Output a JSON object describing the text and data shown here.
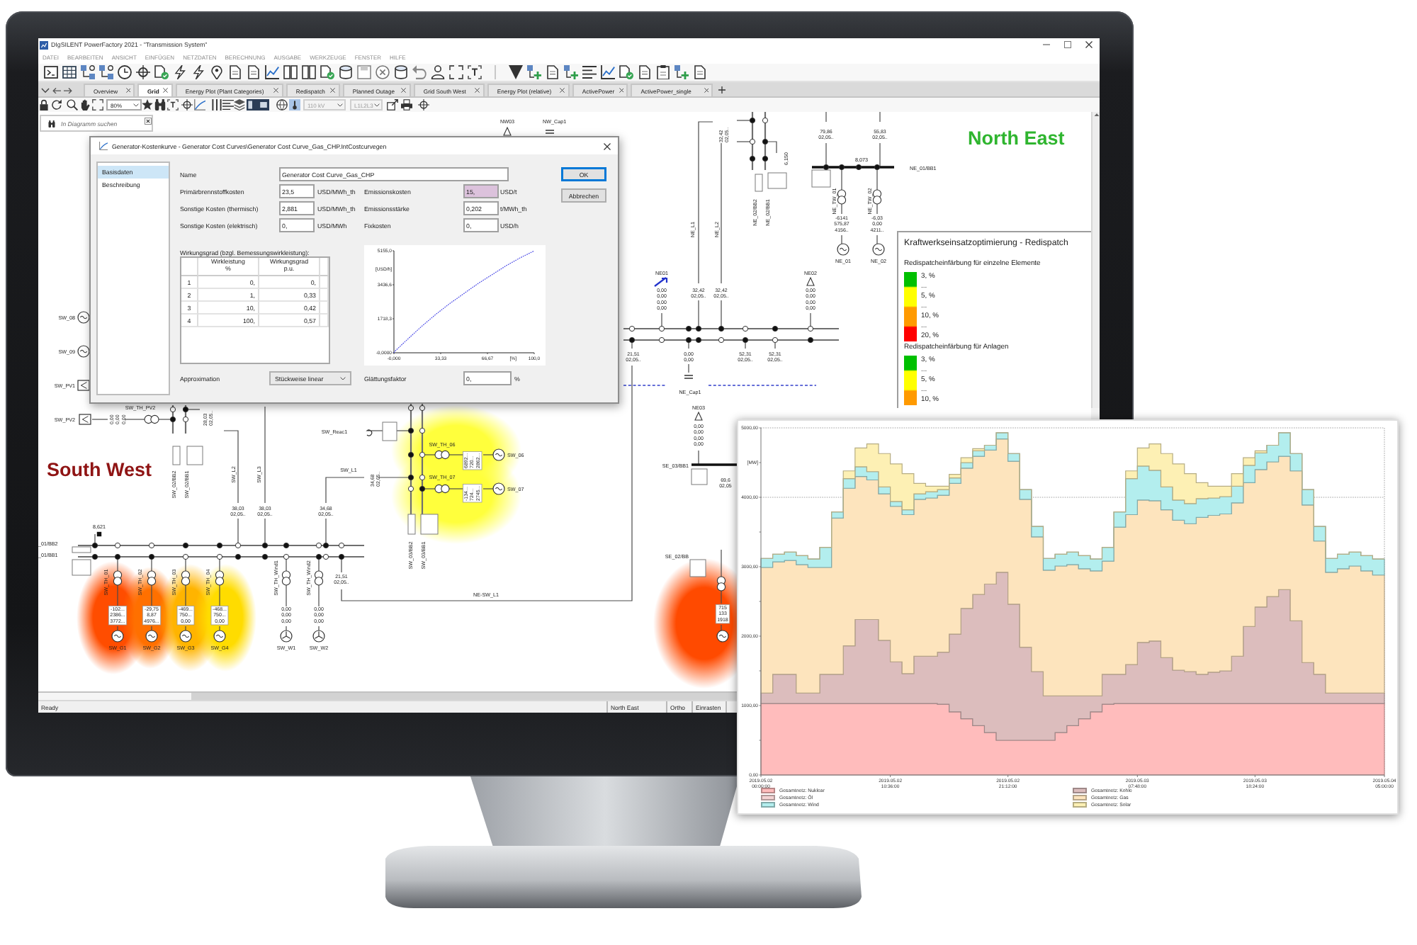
{
  "window": {
    "title": "DIgSILENT PowerFactory 2021 - \"Transmission System\"",
    "menu": [
      "DATEI",
      "BEARBEITEN",
      "ANSICHT",
      "EINFÜGEN",
      "NETZDATEN",
      "BERECHNUNG",
      "AUSGABE",
      "WERKZEUGE",
      "FENSTER",
      "HILFE"
    ]
  },
  "tabs": [
    {
      "label": "Overview",
      "selected": false
    },
    {
      "label": "Grid",
      "selected": true
    },
    {
      "label": "Energy Plot (Plant Categories)",
      "selected": false
    },
    {
      "label": "Redispatch",
      "selected": false
    },
    {
      "label": "Planned Outage",
      "selected": false
    },
    {
      "label": "Grid South West",
      "selected": false
    },
    {
      "label": "Energy Plot (relative)",
      "selected": false
    },
    {
      "label": "ActivePower",
      "selected": false
    },
    {
      "label": "ActivePower_single",
      "selected": false
    }
  ],
  "view_toolbar": {
    "zoom": {
      "value": "80%",
      "disabled": false
    },
    "voltage": {
      "value": "110 kV",
      "disabled": true
    },
    "phase": {
      "value": "L1L2L3",
      "disabled": true
    }
  },
  "diagram": {
    "search": {
      "placeholder": "In Diagramm suchen"
    },
    "regions": [
      {
        "text": "North East",
        "color": "#2fb52f"
      },
      {
        "text": "South West",
        "color": "#8f1414"
      }
    ],
    "labels": [
      "NW03",
      "NW_Cap1",
      "6,150",
      "8,073",
      "NE_01/BB1",
      "NE_02/BB2",
      "NE_02/BB1",
      "NE_TW_01",
      "NE_TW_02",
      "NE_L1",
      "NE_L2",
      "NE01",
      "NE02",
      "NE_Cap1",
      "NE03",
      "SE_03/BB1",
      "SE_02/BB",
      "SW_TH_PV2",
      "SW_02/BB2",
      "SW_02/BB1",
      "SW_L2",
      "SW_L3",
      "SW_Reac1",
      "SW_L1",
      "SW_TH_06",
      "SW_TH_07",
      "SW_03/BB2",
      "SW_03/BB1",
      "8,621",
      "_01/BB2",
      "_01/BB1",
      "SW_TH_01",
      "SW_TH_02",
      "SW_TH_03",
      "SW_TH_04",
      "SW_TH_Wind1",
      "SW_TH_Wind2",
      "NE-SW_L1"
    ],
    "generators": [
      {
        "label": "NE_01",
        "kind": "synchronous"
      },
      {
        "label": "NE_02",
        "kind": "synchronous"
      },
      {
        "label": "SW_08",
        "kind": "synchronous"
      },
      {
        "label": "SW_09",
        "kind": "synchronous"
      },
      {
        "label": "SW_PV1",
        "kind": "pv"
      },
      {
        "label": "SW_PV2",
        "kind": "pv"
      },
      {
        "label": "SW_G1",
        "kind": "synchronous",
        "color": "#ff4d00"
      },
      {
        "label": "SW_G2",
        "kind": "synchronous",
        "color": "#ff7000"
      },
      {
        "label": "SW_G3",
        "kind": "synchronous",
        "color": "#ffb400"
      },
      {
        "label": "SW_G4",
        "kind": "synchronous",
        "color": "#ffdc00"
      },
      {
        "label": "SW_W1",
        "kind": "wind"
      },
      {
        "label": "SW_W2",
        "kind": "wind"
      },
      {
        "label": "SW_06",
        "kind": "synchronous",
        "color": "#ffff3c"
      },
      {
        "label": "SW_07",
        "kind": "synchronous",
        "color": "#ffff3c"
      },
      {
        "kind": "synchronous",
        "color": "#ff4a00"
      }
    ],
    "results": [
      [
        "79,86",
        "02,05.."
      ],
      [
        "55,83",
        "02,05.."
      ],
      [
        "32,42",
        "02,05.."
      ],
      [
        "-6141",
        "575,87",
        "4156.."
      ],
      [
        "-6,03",
        "0,00",
        "4211.."
      ],
      [
        "0,00",
        "0,00",
        "0,00",
        "0,00"
      ],
      [
        "32,42",
        "02,05.."
      ],
      [
        "32,42",
        "02,05.."
      ],
      [
        "0,00",
        "0,00",
        "0,00",
        "0,00"
      ],
      [
        "21,51",
        "02,05.."
      ],
      [
        "0,00",
        "0,00"
      ],
      [
        "52,31",
        "02,05.."
      ],
      [
        "52,31",
        "02,05.."
      ],
      [
        "0,00",
        "0,00",
        "0,00",
        "0,00"
      ],
      [
        "69,6",
        "02,05"
      ],
      [
        "0,00",
        "0,00",
        "0,00"
      ],
      [
        "28,03",
        "02,05.."
      ],
      [
        "38,03",
        "02,05.."
      ],
      [
        "38,03",
        "02,05.."
      ],
      [
        "34,68",
        "02,05.."
      ],
      [
        "34,68",
        "02,05.."
      ],
      [
        "21,51",
        "02,05.."
      ],
      [
        "-102...",
        "2386...",
        "3772..."
      ],
      [
        "-29,75",
        "8,87",
        "4976..."
      ],
      [
        "-469...",
        "750...",
        "0,00"
      ],
      [
        "-468...",
        "750...",
        "0,00"
      ],
      [
        "0,00",
        "0,00",
        "0,00"
      ],
      [
        "0,00",
        "0,00",
        "0,00"
      ],
      [
        "6892...",
        "720...",
        "2862..."
      ],
      [
        "-134...",
        "724...",
        "2745..."
      ],
      [
        "715",
        "133",
        "1918"
      ]
    ]
  },
  "dialog": {
    "title": "Generator-Kostenkurve - Generator Cost Curves\\Generator Cost Curve_Gas_CHP.IntCostcurvegen",
    "pages": [
      {
        "label": "Basisdaten",
        "selected": true
      },
      {
        "label": "Beschreibung",
        "selected": false
      }
    ],
    "name": {
      "label": "Name",
      "value": "Generator Cost Curve_Gas_CHP"
    },
    "fields": [
      {
        "label": "Primärbrennstoffkosten",
        "value": "23,5",
        "unit": "USD/MWh_th",
        "highlighted": false
      },
      {
        "label": "Emissionskosten",
        "value": "15,",
        "unit": "USD/t",
        "highlighted": true
      },
      {
        "label": "Sonstige Kosten (thermisch)",
        "value": "2,881",
        "unit": "USD/MWh_th",
        "highlighted": false
      },
      {
        "label": "Emissionsstärke",
        "value": "0,202",
        "unit": "t/MWh_th",
        "highlighted": false
      },
      {
        "label": "Sonstige Kosten (elektrisch)",
        "value": "0,",
        "unit": "USD/MWh",
        "highlighted": false
      },
      {
        "label": "Fixkosten",
        "value": "0,",
        "unit": "USD/h",
        "highlighted": false
      }
    ],
    "efficiency": {
      "title": "Wirkungsgrad (bzgl. Bemessungswirkleistung):",
      "columns": [
        {
          "label": "Wirkleistung",
          "unit": "%"
        },
        {
          "label": "Wirkungsgrad",
          "unit": "p.u."
        }
      ],
      "rows": [
        {
          "index": "1",
          "values": [
            "0,",
            "0,"
          ]
        },
        {
          "index": "2",
          "values": [
            "1,",
            "0,33"
          ]
        },
        {
          "index": "3",
          "values": [
            "10,",
            "0,42"
          ]
        },
        {
          "index": "4",
          "values": [
            "100,",
            "0,57"
          ]
        }
      ]
    },
    "chart_data": {
      "type": "line",
      "xlabel": "[%]",
      "ylabel": "[USD/h]",
      "x": [
        0,
        1,
        10,
        20,
        30,
        40,
        50,
        60,
        70,
        80,
        90,
        100
      ],
      "series": [
        {
          "color": "#4a4ae6",
          "line_style": "dotted",
          "values": [
            0,
            100,
            700,
            1350,
            1950,
            2500,
            3000,
            3500,
            3950,
            4400,
            4800,
            5150
          ]
        }
      ],
      "xlim": [
        0,
        100
      ],
      "ylim": [
        0,
        5155
      ],
      "xticks": [
        {
          "value": 0,
          "label": "-0,000"
        },
        {
          "value": 33.33,
          "label": "33,33"
        },
        {
          "value": 66.67,
          "label": "66,67"
        },
        {
          "value": 100,
          "label": "100,0"
        }
      ],
      "yticks": [
        {
          "value": 0,
          "label": "-0,0000"
        },
        {
          "value": 1718.3,
          "label": "1718,3"
        },
        {
          "value": 3436.6,
          "label": "3436,6"
        },
        {
          "value": 5155,
          "label": "5155,0"
        }
      ]
    },
    "approximation": {
      "label": "Approximation",
      "value": "Stückweise linear"
    },
    "smoothing": {
      "label": "Glättungsfaktor",
      "value": "0,",
      "unit": "%"
    },
    "buttons": [
      {
        "label": "OK",
        "default": true
      },
      {
        "label": "Abbrechen",
        "default": false
      }
    ]
  },
  "legend": {
    "title": "Kraftwerkseinsatzoptimierung - Redispatch",
    "sections": [
      {
        "title": "Redispatcheinfärbung für einzelne Elemente",
        "stops": [
          {
            "label": "3, %",
            "color": "#00c000"
          },
          {
            "label": "..."
          },
          {
            "label": "5, %",
            "color": "#ffff00"
          },
          {
            "label": "..."
          },
          {
            "label": "10, %",
            "color": "#ff9a00"
          },
          {
            "label": "..."
          },
          {
            "label": "20, %",
            "color": "#ff0000"
          }
        ]
      },
      {
        "title": "Redispatcheinfärbung für Anlagen",
        "stops": [
          {
            "label": "3, %",
            "color": "#00c000"
          },
          {
            "label": "..."
          },
          {
            "label": "5, %",
            "color": "#ffff00"
          },
          {
            "label": "..."
          },
          {
            "label": "10, %",
            "color": "#ff9a00"
          }
        ]
      }
    ]
  },
  "status_bar": [
    "Ready",
    "North East",
    "Ortho",
    "Einrasten"
  ],
  "energy_chart": {
    "chart_data": {
      "type": "area",
      "stacked": true,
      "ylabel": "[MW]",
      "ylim": [
        0,
        5000
      ],
      "categories": [
        "2019.05.02 00:00:00",
        null,
        null,
        null,
        null,
        null,
        null,
        null,
        null,
        null,
        null,
        "2019.05.02 10:36:00",
        null,
        null,
        null,
        null,
        null,
        null,
        null,
        null,
        null,
        "2019.05.02 21:12:00",
        null,
        null,
        null,
        null,
        null,
        null,
        null,
        null,
        null,
        null,
        "2019.05.03 07:48:00",
        null,
        null,
        null,
        null,
        null,
        null,
        null,
        null,
        null,
        "2019.05.03 18:24:00",
        null,
        null,
        null,
        null,
        null,
        null,
        null,
        null,
        null,
        null,
        "2019.05.04 05:00:00"
      ],
      "yticks": [
        {
          "value": 0,
          "label": "0,00"
        },
        {
          "value": 1000,
          "label": "1000,00"
        },
        {
          "value": 2000,
          "label": "2000,00"
        },
        {
          "value": 3000,
          "label": "3000,00"
        },
        {
          "value": 4000,
          "label": "4000,00"
        },
        {
          "value": 5000,
          "label": "5000,00"
        }
      ],
      "series": [
        {
          "name": "Gesamtnetz: Nuklear",
          "color": "#ffbcbc",
          "values": [
            1030,
            1030,
            1030,
            1030,
            1030,
            1030,
            1030,
            1030,
            1030,
            1030,
            1030,
            1030,
            1030,
            1030,
            1030,
            1020,
            910,
            810,
            710,
            610,
            500,
            500,
            500,
            500,
            500,
            610,
            710,
            810,
            910,
            1020,
            1030,
            1030,
            1030,
            1030,
            1030,
            1030,
            1030,
            1030,
            1030,
            1030,
            1030,
            1030,
            1030,
            1030,
            1030,
            1030,
            1030,
            1030,
            1030,
            1030,
            1030,
            1030,
            1030,
            1030
          ]
        },
        {
          "name": "Gesamtnetz: Kohle",
          "color": "#dcbdbd",
          "values": [
            150,
            420,
            420,
            150,
            150,
            420,
            420,
            830,
            1210,
            1210,
            910,
            600,
            430,
            680,
            680,
            750,
            1120,
            1590,
            1890,
            2140,
            2420,
            1960,
            1340,
            990,
            640,
            530,
            430,
            330,
            230,
            430,
            420,
            560,
            880,
            900,
            660,
            480,
            460,
            420,
            450,
            470,
            680,
            1110,
            1390,
            1540,
            1640,
            1190,
            590,
            420,
            150,
            150,
            150,
            150,
            150,
            150
          ]
        },
        {
          "name": "Gesamtnetz: Öl",
          "color": "#f3d3d3",
          "values": [
            null,
            null,
            null,
            null,
            null,
            null,
            null,
            null,
            null,
            null,
            null,
            null,
            null,
            null,
            null,
            null,
            null,
            null,
            null,
            null,
            null,
            null,
            null,
            null,
            null,
            null,
            null,
            null,
            null,
            null,
            null,
            null,
            null,
            null,
            null,
            null,
            null,
            null,
            null,
            null,
            null,
            null,
            null,
            null,
            null,
            null,
            null,
            null,
            null,
            null,
            null,
            null,
            null,
            null
          ]
        },
        {
          "name": "Gesamtnetz: Gas",
          "color": "#fde4bd",
          "values": [
            1810,
            1620,
            1640,
            1850,
            1810,
            1540,
            2250,
            2270,
            2060,
            2010,
            2110,
            2240,
            2290,
            2260,
            2280,
            2260,
            2170,
            2020,
            1990,
            1930,
            1920,
            2060,
            2130,
            1940,
            1810,
            1870,
            1890,
            1830,
            1800,
            1630,
            2120,
            2160,
            2050,
            2020,
            2130,
            2160,
            2130,
            2260,
            2260,
            2260,
            2210,
            2070,
            1980,
            1940,
            1920,
            2160,
            2270,
            1920,
            1740,
            1790,
            1830,
            1760,
            1700,
            1700
          ]
        },
        {
          "name": "Gesamtnetz: Wind",
          "color": "#b3eeee",
          "values": [
            130,
            110,
            120,
            130,
            120,
            290,
            90,
            140,
            140,
            120,
            100,
            70,
            70,
            80,
            90,
            80,
            80,
            80,
            80,
            70,
            90,
            110,
            140,
            150,
            170,
            170,
            180,
            190,
            170,
            200,
            220,
            520,
            490,
            440,
            330,
            290,
            290,
            270,
            250,
            250,
            240,
            250,
            240,
            240,
            340,
            250,
            220,
            210,
            200,
            210,
            200,
            220,
            230,
            230
          ]
        },
        {
          "name": "Gesamtnetz: Solar",
          "color": "#fdf0b4",
          "values": [
            0,
            0,
            0,
            0,
            0,
            0,
            0,
            110,
            270,
            400,
            480,
            540,
            520,
            150,
            80,
            50,
            50,
            70,
            30,
            0,
            0,
            0,
            0,
            0,
            0,
            0,
            0,
            0,
            0,
            0,
            0,
            110,
            260,
            380,
            480,
            520,
            430,
            230,
            170,
            150,
            180,
            110,
            30,
            0,
            0,
            0,
            0,
            0,
            0,
            0,
            0,
            0,
            0,
            0
          ]
        }
      ]
    }
  }
}
